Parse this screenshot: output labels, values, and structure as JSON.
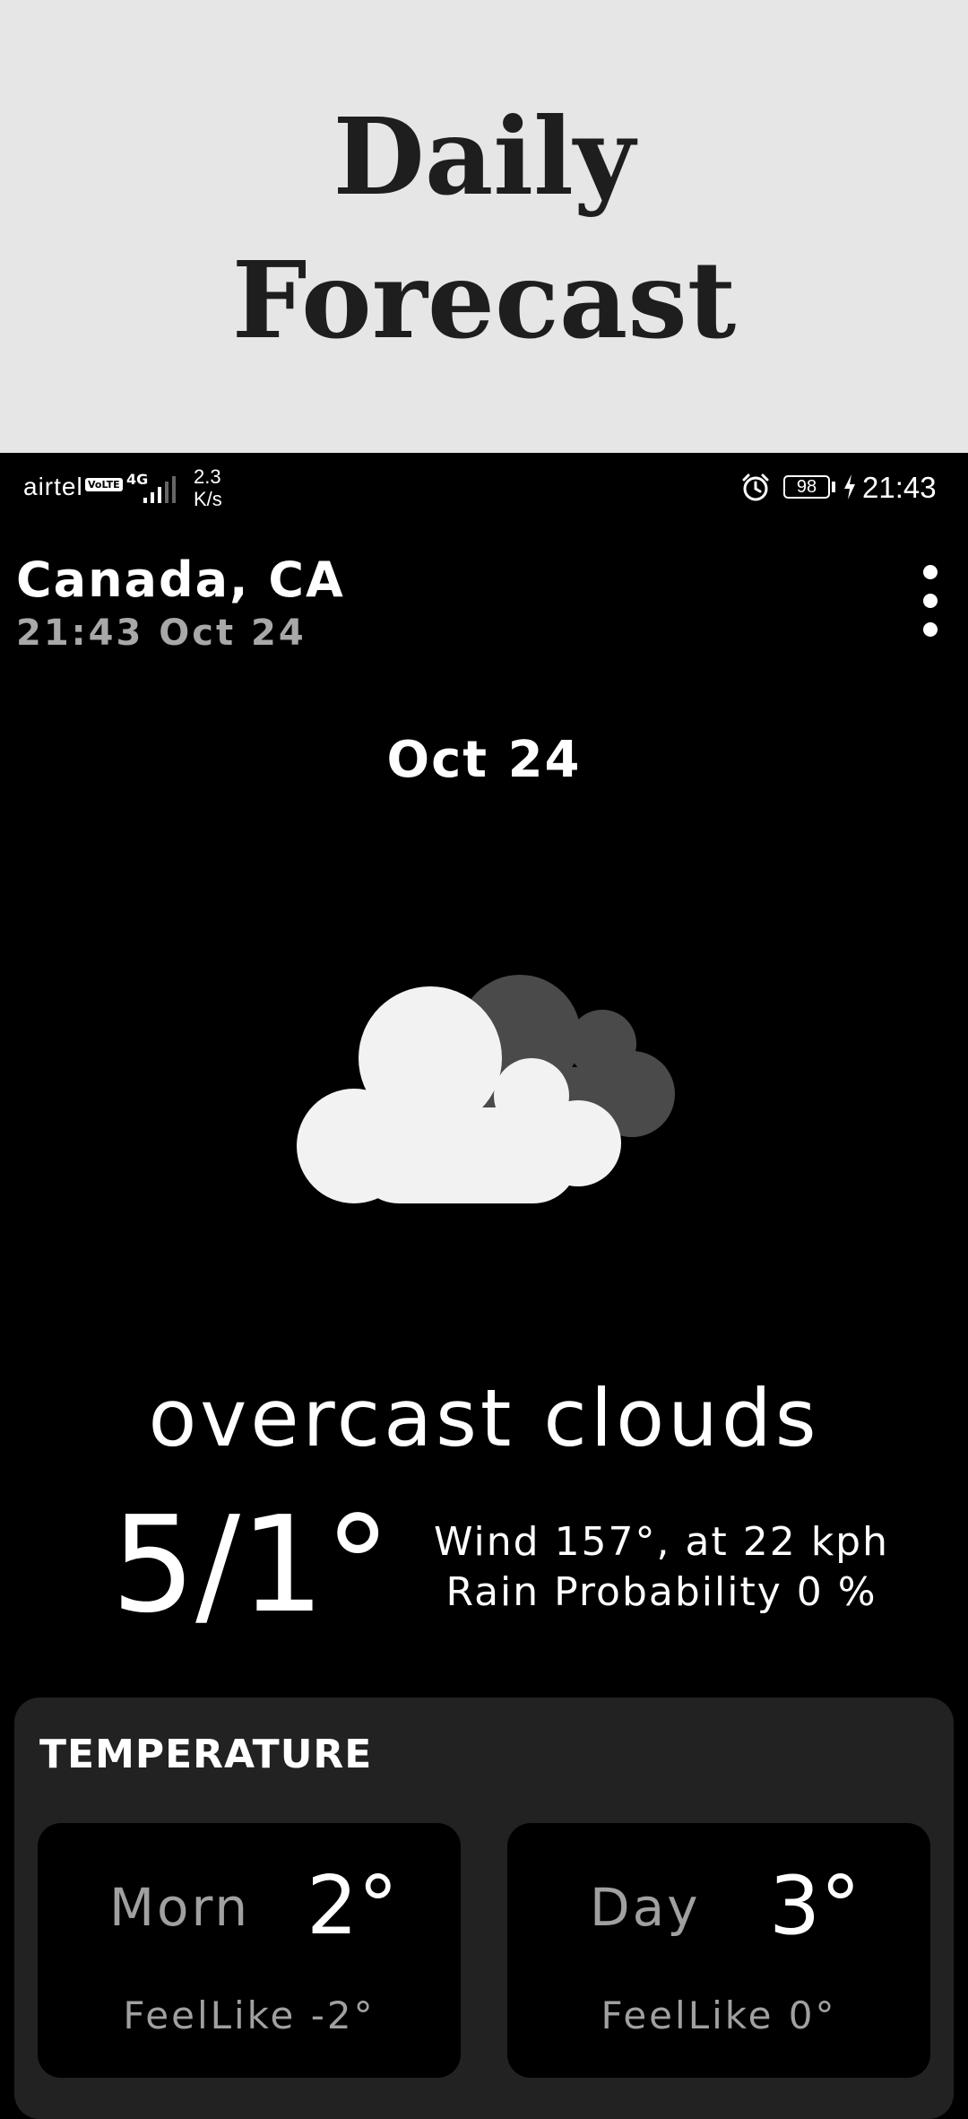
{
  "banner": {
    "title": "Daily Forecast"
  },
  "status_bar": {
    "carrier": "airtel",
    "volte": "VoLTE",
    "network": "4G",
    "speed_value": "2.3",
    "speed_unit": "K/s",
    "battery": "98",
    "time": "21:43"
  },
  "header": {
    "location": "Canada, CA",
    "datetime": "21:43 Oct 24"
  },
  "forecast": {
    "date": "Oct 24",
    "icon": "overcast-clouds-icon",
    "condition": "overcast clouds",
    "temp_range": "5/1°",
    "wind": "Wind 157°, at 22 kph",
    "rain": "Rain Probability 0 %"
  },
  "temperature": {
    "title": "TEMPERATURE",
    "cards": [
      {
        "label": "Morn",
        "value": "2°",
        "feels": "FeelLike -2°"
      },
      {
        "label": "Day",
        "value": "3°",
        "feels": "FeelLike 0°"
      }
    ]
  },
  "colors": {
    "banner_bg": "#e6e6e6",
    "banner_text": "#1e1e1e",
    "screen_bg": "#000000",
    "panel_bg": "#222222",
    "muted_text": "#a8a8a8"
  }
}
